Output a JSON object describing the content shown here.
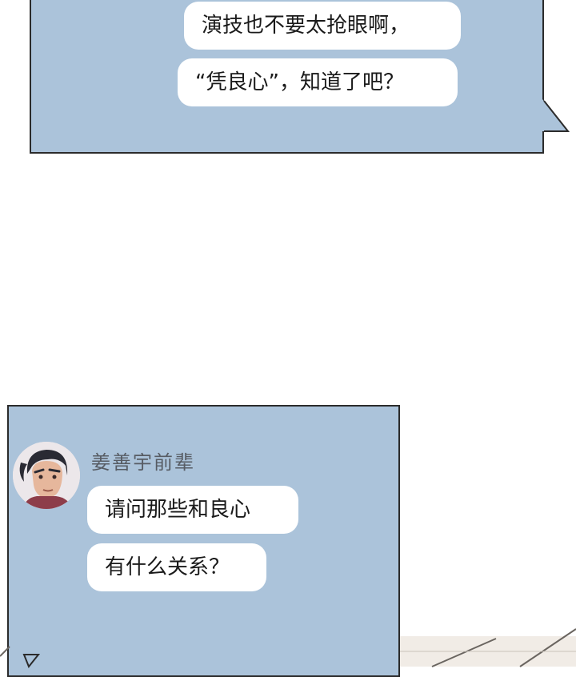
{
  "messages_top": [
    {
      "text": "演技也不要太抢眼啊，"
    },
    {
      "text": "“凭良心”，知道了吧？"
    }
  ],
  "chat_bottom": {
    "sender": "姜善宇前辈",
    "avatar_icon": "person-avatar-icon",
    "messages": [
      {
        "text": "请问那些和良心"
      },
      {
        "text": "有什么关系？"
      }
    ]
  },
  "colors": {
    "panel_background": "#abc3da",
    "bubble_background": "#ffffff",
    "panel_border": "#2b2b2b",
    "sender_name": "#575c64"
  }
}
